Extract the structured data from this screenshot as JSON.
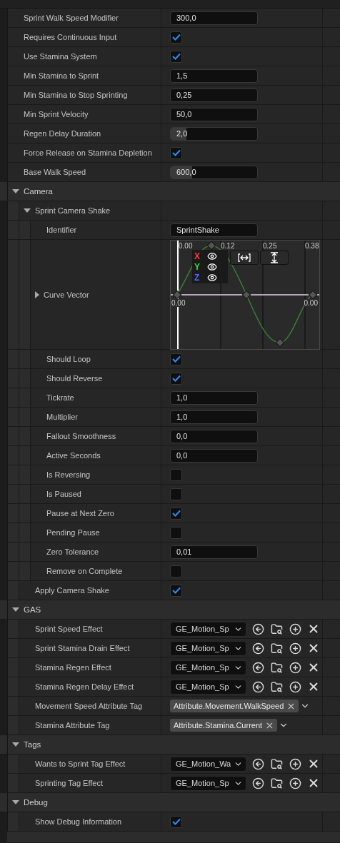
{
  "top_rows": [
    {
      "kind": "number",
      "label": "Sprint Walk Speed Modifier",
      "value": "300,0"
    },
    {
      "kind": "checkbox",
      "label": "Requires Continuous Input",
      "checked": true
    },
    {
      "kind": "checkbox",
      "label": "Use Stamina System",
      "checked": true
    },
    {
      "kind": "number",
      "label": "Min Stamina to Sprint",
      "value": "1,5"
    },
    {
      "kind": "number",
      "label": "Min Stamina to Stop Sprinting",
      "value": "0,25"
    },
    {
      "kind": "number",
      "label": "Min Sprint Velocity",
      "value": "50,0"
    },
    {
      "kind": "number",
      "label": "Regen Delay Duration",
      "value": "2,0",
      "level": 0.18
    },
    {
      "kind": "checkbox",
      "label": "Force Release on Stamina Depletion",
      "checked": true
    },
    {
      "kind": "number",
      "label": "Base Walk Speed",
      "value": "600,0",
      "level": 0.25
    }
  ],
  "categories": [
    {
      "title": "Camera",
      "expanded": true,
      "rows": [
        {
          "kind": "group",
          "label": "Sprint Camera Shake",
          "expanded": true,
          "children": [
            {
              "kind": "text",
              "label": "Identifier",
              "value": "SprintShake"
            },
            {
              "kind": "curve",
              "label": "Curve Vector",
              "expanded": false,
              "x_ticks": [
                "0.00",
                "0.12",
                "0.25",
                "0.38"
              ],
              "y_labels": [
                "0.00",
                "0.00"
              ],
              "channels": [
                {
                  "label": "X",
                  "color": "#ff3b3b"
                },
                {
                  "label": "Y",
                  "color": "#3bdc3b"
                },
                {
                  "label": "Z",
                  "color": "#4a6cff"
                }
              ]
            },
            {
              "kind": "checkbox",
              "label": "Should Loop",
              "checked": true
            },
            {
              "kind": "checkbox",
              "label": "Should Reverse",
              "checked": true
            },
            {
              "kind": "number",
              "label": "Tickrate",
              "value": "1,0"
            },
            {
              "kind": "number",
              "label": "Multiplier",
              "value": "1,0"
            },
            {
              "kind": "number",
              "label": "Fallout Smoothness",
              "value": "0,0"
            },
            {
              "kind": "number",
              "label": "Active Seconds",
              "value": "0,0"
            },
            {
              "kind": "checkbox",
              "label": "Is Reversing",
              "checked": false
            },
            {
              "kind": "checkbox",
              "label": "Is Paused",
              "checked": false
            },
            {
              "kind": "checkbox",
              "label": "Pause at Next Zero",
              "checked": true
            },
            {
              "kind": "checkbox",
              "label": "Pending Pause",
              "checked": false
            },
            {
              "kind": "number",
              "label": "Zero Tolerance",
              "value": "0,01"
            },
            {
              "kind": "checkbox",
              "label": "Remove on Complete",
              "checked": false
            }
          ]
        },
        {
          "kind": "checkbox",
          "label": "Apply Camera Shake",
          "checked": true
        }
      ]
    },
    {
      "title": "GAS",
      "expanded": true,
      "rows": [
        {
          "kind": "asset",
          "label": "Sprint Speed Effect",
          "value": "GE_Motion_Sp"
        },
        {
          "kind": "asset",
          "label": "Sprint Stamina Drain Effect",
          "value": "GE_Motion_Sp"
        },
        {
          "kind": "asset",
          "label": "Stamina Regen Effect",
          "value": "GE_Motion_Sp"
        },
        {
          "kind": "asset",
          "label": "Stamina Regen Delay Effect",
          "value": "GE_Motion_Sp"
        },
        {
          "kind": "tag",
          "label": "Movement Speed Attribute Tag",
          "value": "Attribute.Movement.WalkSpeed"
        },
        {
          "kind": "tag",
          "label": "Stamina Attribute Tag",
          "value": "Attribute.Stamina.Current"
        }
      ]
    },
    {
      "title": "Tags",
      "expanded": true,
      "rows": [
        {
          "kind": "asset",
          "label": "Wants to Sprint Tag Effect",
          "value": "GE_Motion_Wa"
        },
        {
          "kind": "asset",
          "label": "Sprinting Tag Effect",
          "value": "GE_Motion_Sp"
        }
      ]
    },
    {
      "title": "Debug",
      "expanded": true,
      "rows": [
        {
          "kind": "checkbox",
          "label": "Show Debug Information",
          "checked": true
        }
      ]
    }
  ]
}
